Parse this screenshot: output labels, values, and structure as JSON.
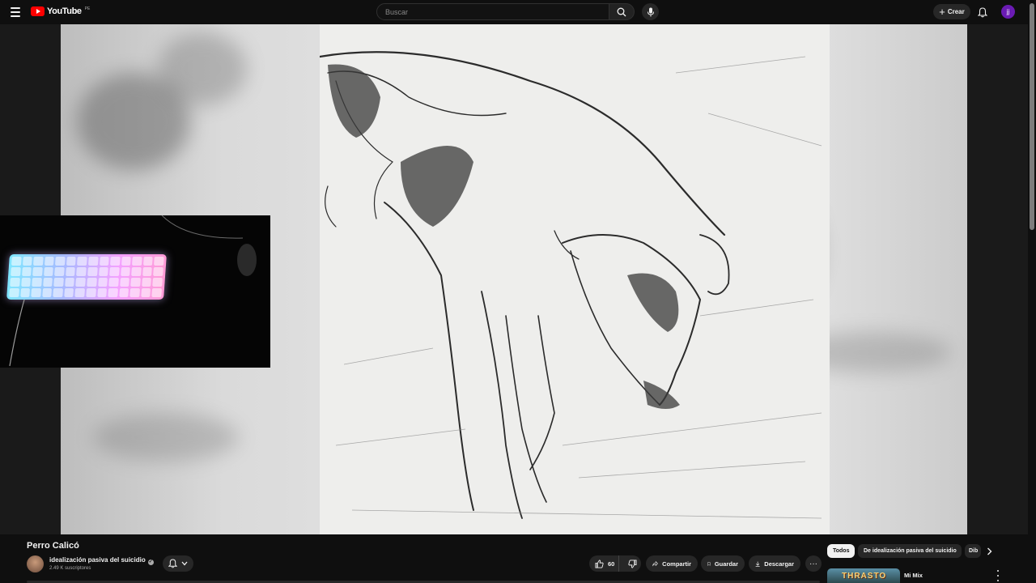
{
  "app": {
    "logo_text": "YouTube",
    "country_code": "PE"
  },
  "header": {
    "search_placeholder": "Buscar",
    "create_label": "Crear",
    "avatar_initial": "jj"
  },
  "video": {
    "title": "Perro Calicó",
    "channel_name": "idealización pasiva del suicidio",
    "subscribers": "2.49 K suscriptores",
    "likes": "60"
  },
  "actions": {
    "share_label": "Compartir",
    "save_label": "Guardar",
    "download_label": "Descargar"
  },
  "chips": [
    {
      "label": "Todos",
      "active": true
    },
    {
      "label": "De idealización pasiva del suicidio",
      "active": false
    },
    {
      "label": "Dib",
      "active": false
    }
  ],
  "recommendation": {
    "thumb_text": "THRASTO",
    "title": "Mi Mix"
  },
  "colors": {
    "background": "#0f0f0f",
    "surface": "#272727",
    "brand_red": "#ff0000",
    "avatar_purple": "#6a1bb3"
  }
}
